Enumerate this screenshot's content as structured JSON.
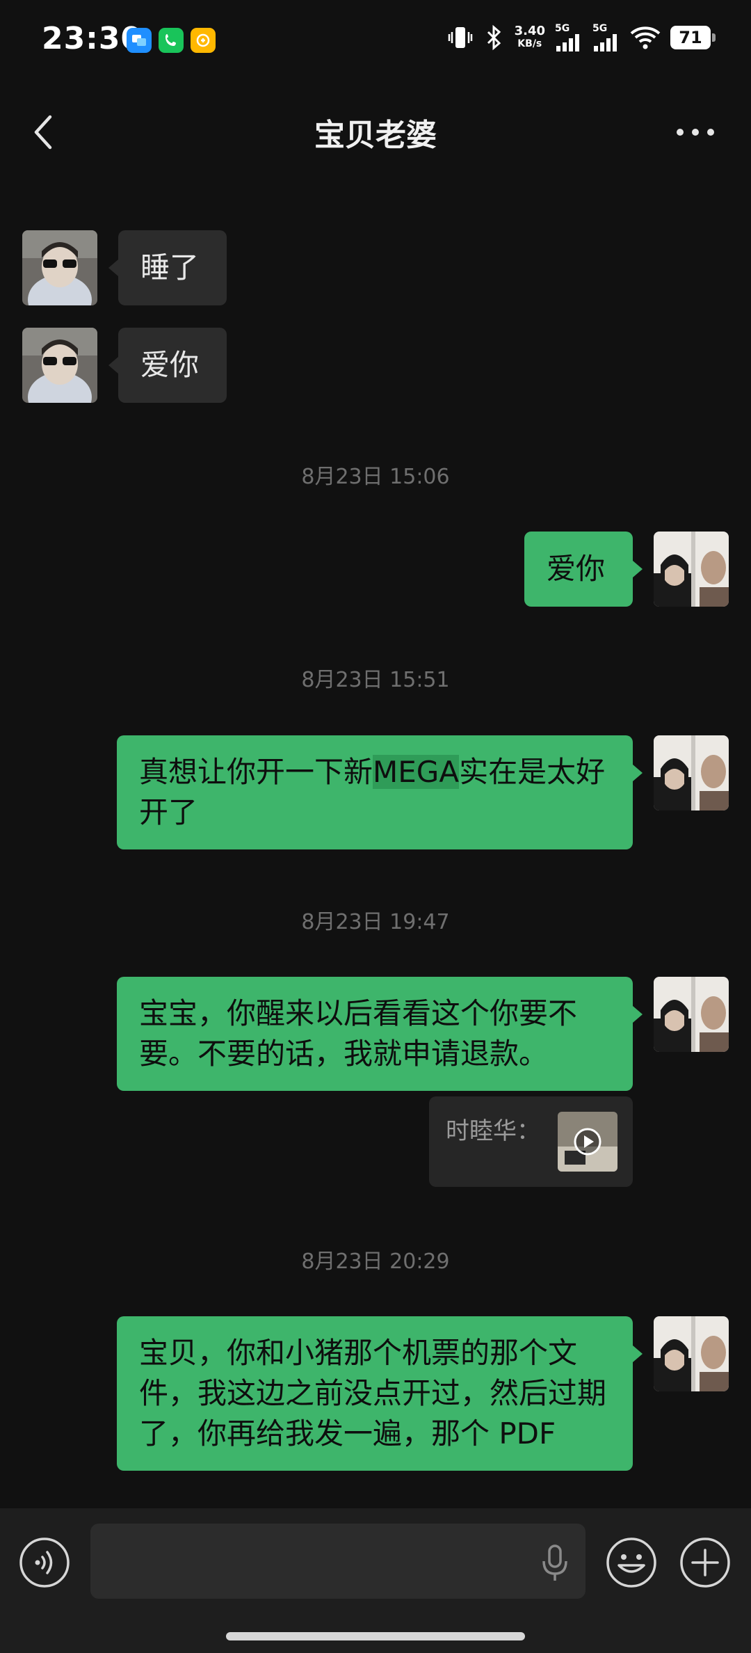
{
  "status_bar": {
    "time": "23:30",
    "net_speed_value": "3.40",
    "net_speed_unit": "KB/s",
    "sim1_tag": "5G",
    "sim2_tag": "5G",
    "battery_level": "71",
    "icons": [
      "app-blue-icon",
      "phone-green-icon",
      "app-yellow-icon",
      "vibrate-icon",
      "bluetooth-icon",
      "signal-icon",
      "signal-icon",
      "wifi-icon",
      "battery-icon"
    ]
  },
  "header": {
    "title": "宝贝老婆",
    "back_icon": "chevron-left-icon",
    "more_icon": "more-dots-icon"
  },
  "messages": [
    {
      "dir": "in",
      "text": "睡了"
    },
    {
      "dir": "in",
      "text": "爱你"
    },
    {
      "type": "time",
      "text": "8月23日 15:06"
    },
    {
      "dir": "out",
      "text": "爱你"
    },
    {
      "type": "time",
      "text": "8月23日 15:51"
    },
    {
      "dir": "out",
      "text_before": "真想让你开一下新",
      "text_highlight": "MEGA",
      "text_after": "实在是太好开了"
    },
    {
      "type": "time",
      "text": "8月23日 19:47"
    },
    {
      "dir": "out",
      "text": "宝宝，你醒来以后看看这个你要不要。不要的话，我就申请退款。",
      "quote_name": "时睦华："
    },
    {
      "type": "time",
      "text": "8月23日 20:29"
    },
    {
      "dir": "out",
      "text": "宝贝，你和小猪那个机票的那个文件，我这边之前没点开过，然后过期了，你再给我发一遍，那个 PDF"
    }
  ],
  "input_bar": {
    "voice_icon": "voice-mode-icon",
    "mic_icon": "microphone-icon",
    "emoji_icon": "emoji-icon",
    "plus_icon": "plus-icon",
    "input_value": ""
  },
  "colors": {
    "background": "#111111",
    "outgoing_bubble": "#3eb56b",
    "incoming_bubble": "#2c2c2c",
    "timestamp": "#6f6f6f"
  }
}
